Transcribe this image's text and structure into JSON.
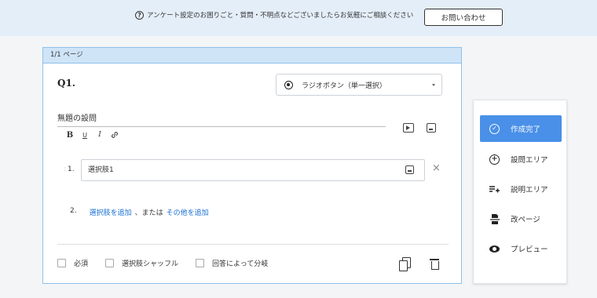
{
  "header": {
    "help_text": "アンケート設定のお困りごと・質問・不明点などございましたらお気軽にご相談ください",
    "help_icon": "question-circle-icon",
    "contact_label": "お問い合わせ"
  },
  "page": {
    "indicator": "1/1 ページ"
  },
  "question": {
    "number": "Q1.",
    "type_label": "ラジオボタン（単一選択）",
    "title": "無題の設問",
    "format_buttons": {
      "bold": "B",
      "underline": "U",
      "italic": "I",
      "link": "🔗"
    },
    "options": [
      {
        "number": "1.",
        "value": "選択肢1"
      }
    ],
    "add_row": {
      "number": "2.",
      "add_choice_label": "選択肢を追加",
      "or_label": "、または",
      "add_other_label": "その他を追加"
    },
    "footer": {
      "required_label": "必須",
      "shuffle_label": "選択肢シャッフル",
      "branch_label": "回答によって分岐"
    }
  },
  "side_menu": {
    "items": [
      {
        "label": "作成完了",
        "icon": "check-circle-icon",
        "active": true
      },
      {
        "label": "設問エリア",
        "icon": "plus-circle-icon",
        "active": false
      },
      {
        "label": "説明エリア",
        "icon": "text-add-icon",
        "active": false
      },
      {
        "label": "改ページ",
        "icon": "page-break-icon",
        "active": false
      },
      {
        "label": "プレビュー",
        "icon": "eye-icon",
        "active": false
      }
    ]
  },
  "colors": {
    "accent": "#4a90e8",
    "link": "#1a6fd3",
    "header_bg": "#e4eef8",
    "card_border": "#8fc1ea",
    "page_header_bg": "#cfe4f7"
  }
}
